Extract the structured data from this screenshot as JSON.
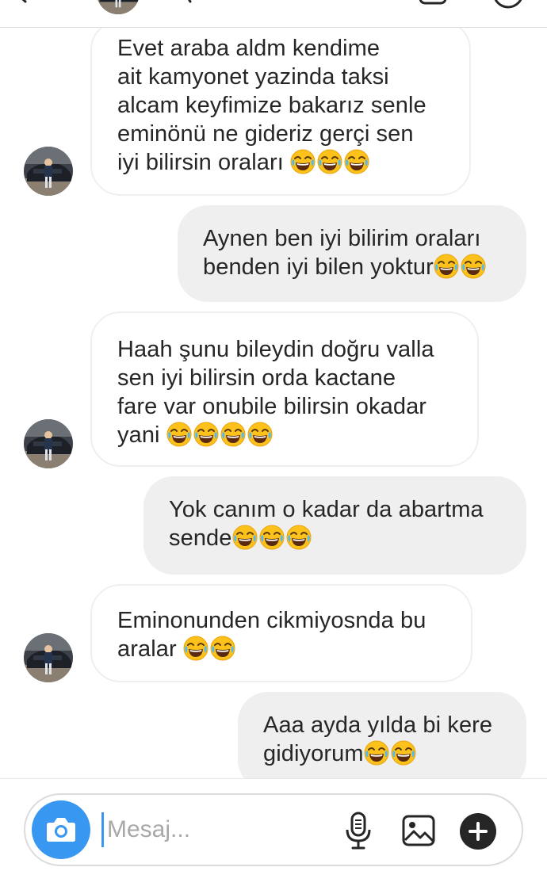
{
  "header": {
    "back_icon": "chevron-left-icon",
    "video_icon": "video-call-icon",
    "info_icon": "info-icon"
  },
  "messages": [
    {
      "direction": "incoming",
      "lines": [
        "Evet araba aldm kendime",
        "ait kamyonet yazinda taksi",
        "alcam keyfimize bakarız senle",
        "eminönü ne gideriz gerçi sen",
        "iyi bilirsin oraları "
      ],
      "emoji": "😂😂😂"
    },
    {
      "direction": "outgoing",
      "lines": [
        "Aynen ben iyi bilirim oraları",
        "benden iyi bilen yoktur"
      ],
      "emoji": "😂😂"
    },
    {
      "direction": "incoming",
      "lines": [
        "Haah şunu bileydin doğru valla",
        "sen iyi bilirsin orda kactane",
        "fare var onubile bilirsin okadar",
        "yani "
      ],
      "emoji": "😂😂😂😂"
    },
    {
      "direction": "outgoing",
      "lines": [
        "Yok canım o kadar da abartma",
        "sende"
      ],
      "emoji": "😂😂😂"
    },
    {
      "direction": "incoming",
      "lines": [
        "Eminonunden cikmiyosnda bu",
        "aralar "
      ],
      "emoji": "😂😂"
    },
    {
      "direction": "outgoing",
      "lines": [
        "Aaa ayda yılda bi kere",
        "gidiyorum"
      ],
      "emoji": "😂😂"
    }
  ],
  "composer": {
    "placeholder": "Mesaj...",
    "value": "",
    "camera_icon": "camera-icon",
    "mic_icon": "microphone-icon",
    "gallery_icon": "gallery-icon",
    "plus_icon": "plus-icon"
  },
  "colors": {
    "accent": "#3897f0",
    "outgoing_bubble": "#efefef",
    "incoming_border": "#efefef",
    "text": "#262626",
    "placeholder": "#a8a8a8"
  }
}
